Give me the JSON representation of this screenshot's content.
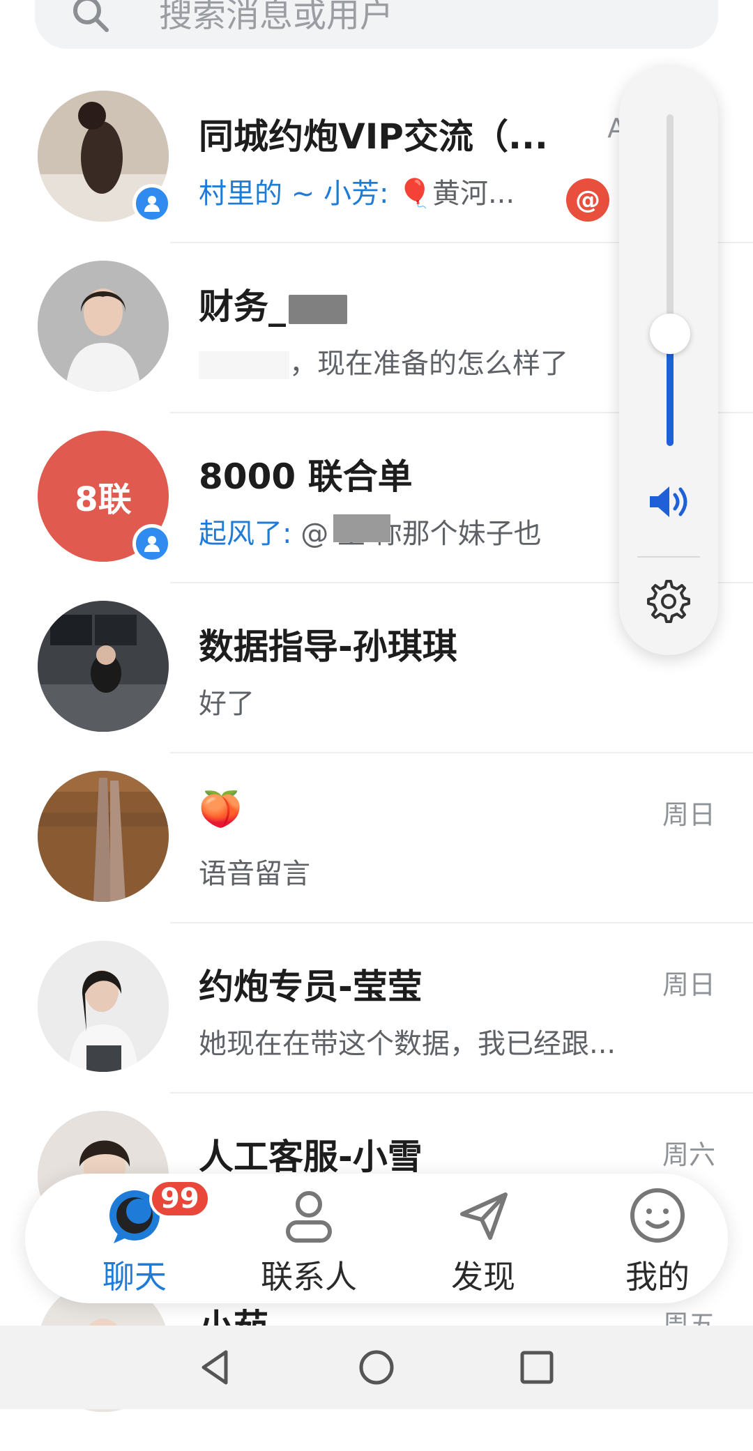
{
  "search": {
    "placeholder": "搜索消息或用户"
  },
  "chats": [
    {
      "name": "同城约炮VIP交流（...",
      "sender": "村里的 ~ 小芳: ",
      "preview": "🎈黄河...",
      "time": "AM",
      "is_group": true,
      "mention": "@"
    },
    {
      "name": "财务_",
      "sender": "",
      "preview": "，现在准备的怎么样了",
      "time": "",
      "is_group": false
    },
    {
      "name": "8000 联合单",
      "avatar_text": "8联",
      "sender": "起风了: ",
      "preview": "@     主 你那个妹子也",
      "time": "",
      "is_group": true
    },
    {
      "name": "数据指导-孙琪琪",
      "sender": "",
      "preview": "好了",
      "time": "",
      "is_group": false
    },
    {
      "name": "🍑",
      "sender": "",
      "preview": "语音留言",
      "time": "周日",
      "is_group": false
    },
    {
      "name": "约炮专员-莹莹",
      "sender": "",
      "preview": "她现在在带这个数据，我已经跟...",
      "time": "周日",
      "is_group": false
    },
    {
      "name": "人工客服-小雪",
      "sender": "",
      "preview": "",
      "time": "周六",
      "is_group": false
    },
    {
      "name": "小茹",
      "sender": "",
      "preview": "",
      "time": "周五",
      "is_group": false
    }
  ],
  "volume": {
    "level_percent": 37,
    "icons": [
      "speaker-icon",
      "gear-icon"
    ]
  },
  "tabs": [
    {
      "label": "聊天",
      "icon": "chat-bubble-icon",
      "badge": "99",
      "active": true
    },
    {
      "label": "联系人",
      "icon": "contacts-icon",
      "active": false
    },
    {
      "label": "发现",
      "icon": "discover-icon",
      "active": false
    },
    {
      "label": "我的",
      "icon": "profile-icon",
      "active": false
    }
  ],
  "colors": {
    "accent": "#1f7bd8",
    "badge": "#e9473a",
    "volume_fill": "#1f5fd8",
    "group_avatar": "#e05a4f"
  }
}
